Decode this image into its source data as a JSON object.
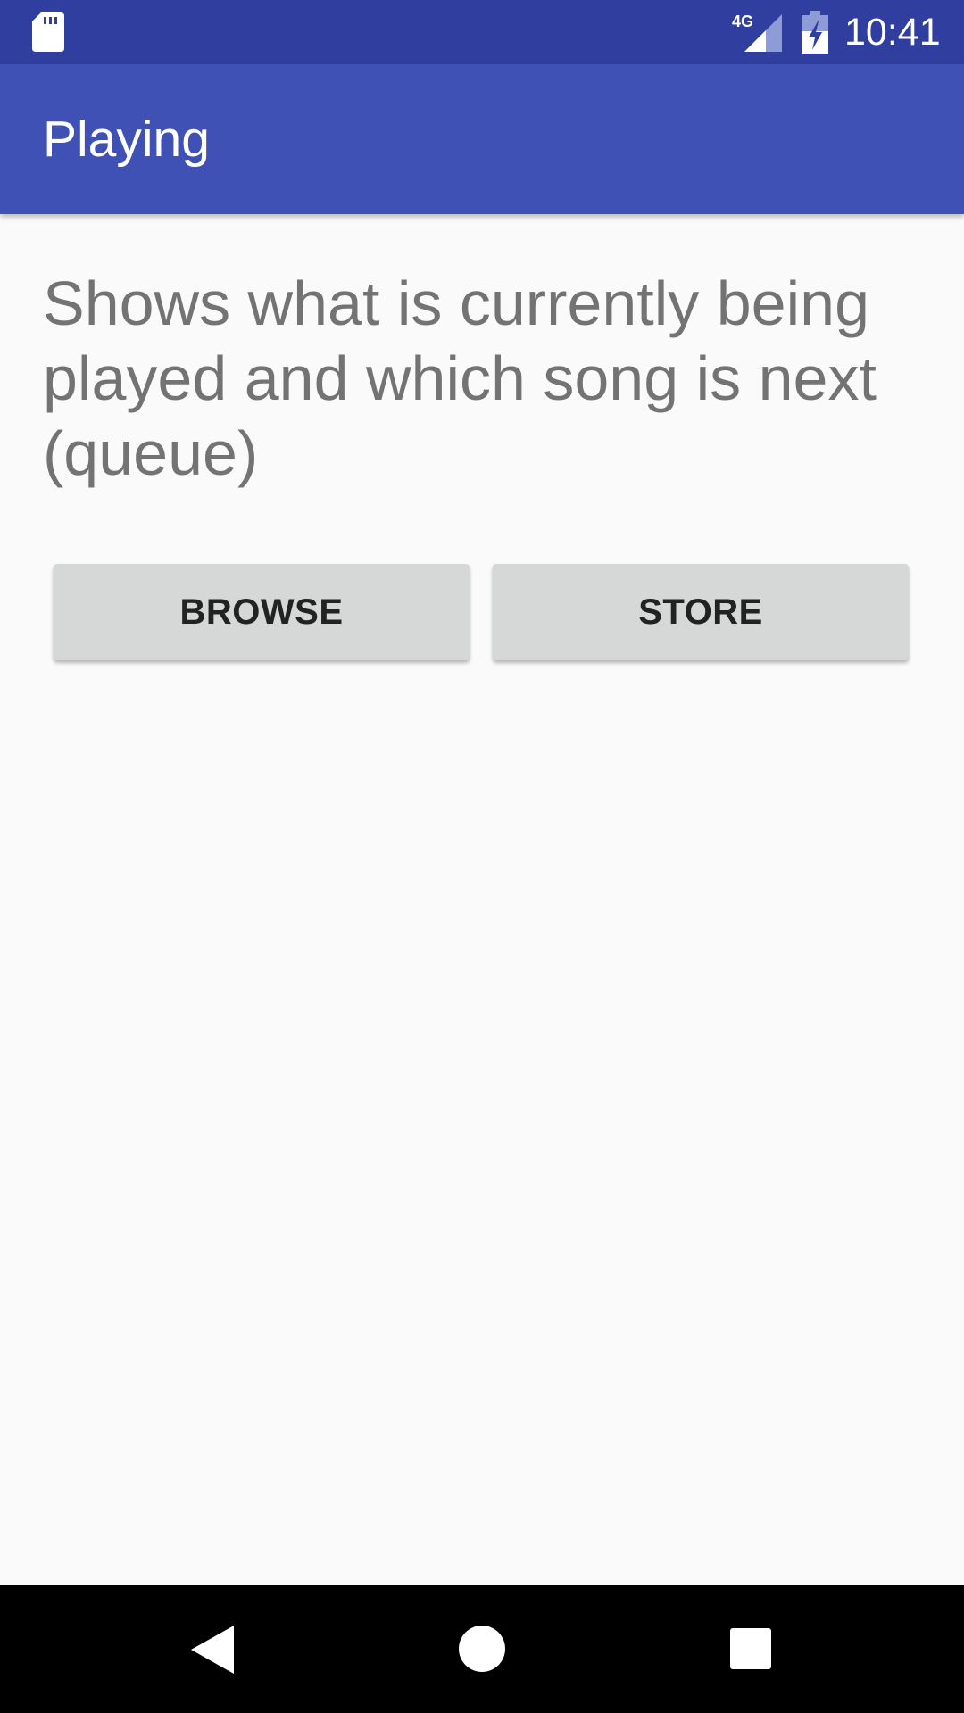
{
  "status_bar": {
    "time": "10:41",
    "network_label": "4G",
    "icons": [
      "sd-card-icon",
      "cell-signal-icon",
      "battery-charging-icon"
    ]
  },
  "app_bar": {
    "title": "Playing"
  },
  "main": {
    "description": "Shows what is currently being played and which song is next (queue)",
    "buttons": [
      {
        "label": "BROWSE"
      },
      {
        "label": "STORE"
      }
    ]
  },
  "nav_bar": {
    "icons": [
      "back-icon",
      "home-icon",
      "recents-icon"
    ]
  },
  "colors": {
    "status_bar": "#303f9f",
    "app_bar": "#3f51b5",
    "background": "#fafafa",
    "button": "#d6d7d7",
    "description_text": "#737373"
  }
}
